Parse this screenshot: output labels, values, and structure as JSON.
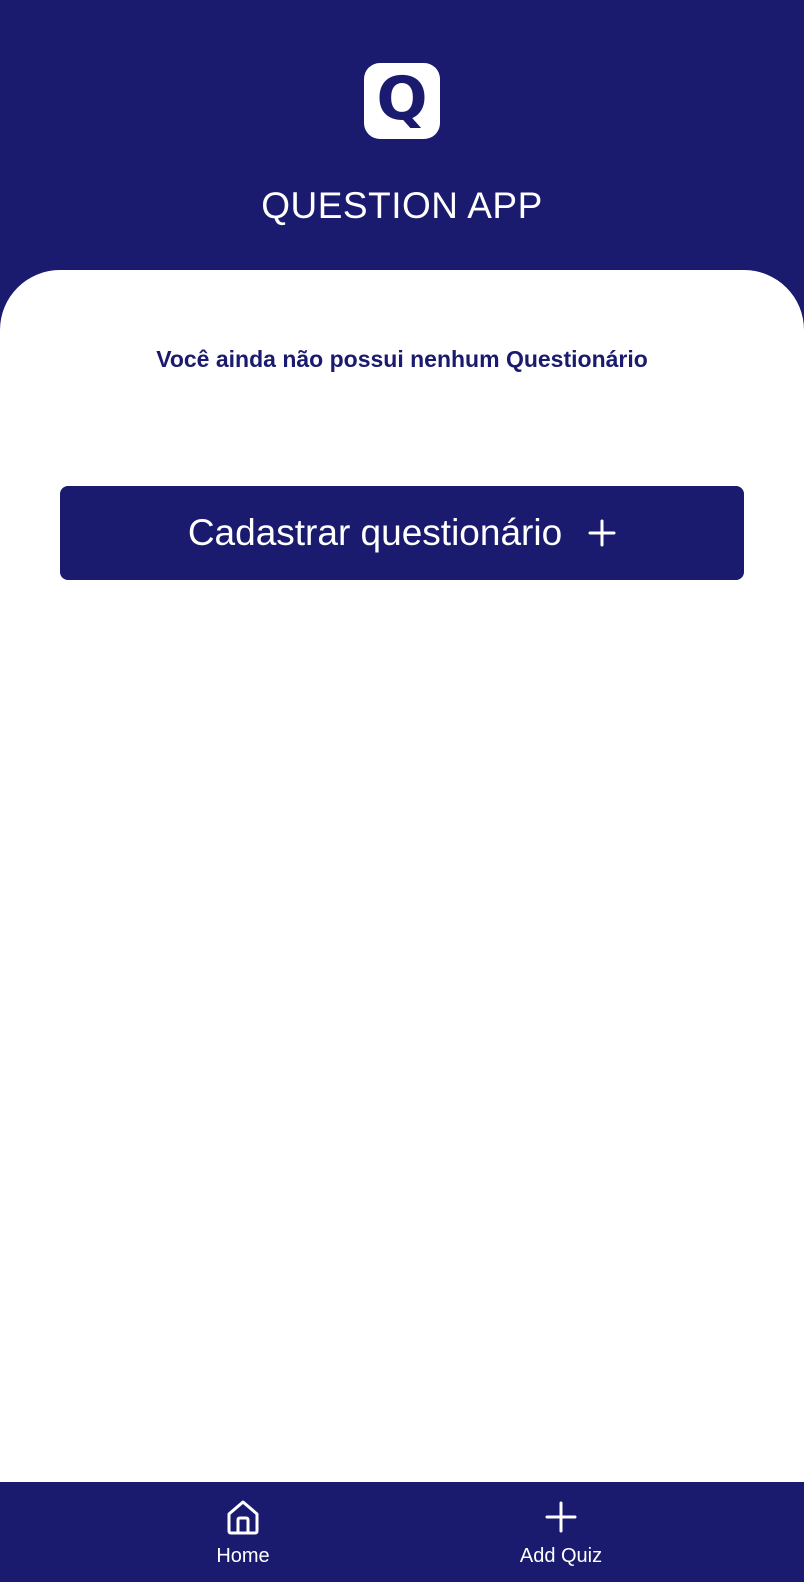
{
  "header": {
    "logo_letter": "Q",
    "title": "QUESTION APP"
  },
  "main": {
    "empty_message": "Você ainda não possui nenhum Questionário",
    "add_button_label": "Cadastrar questionário",
    "add_button_icon": "plus-icon"
  },
  "bottom_nav": {
    "items": [
      {
        "label": "Home",
        "icon": "home-icon"
      },
      {
        "label": "Add Quiz",
        "icon": "plus-icon"
      }
    ]
  },
  "colors": {
    "primary": "#1A1A6E",
    "surface": "#FFFFFF"
  }
}
